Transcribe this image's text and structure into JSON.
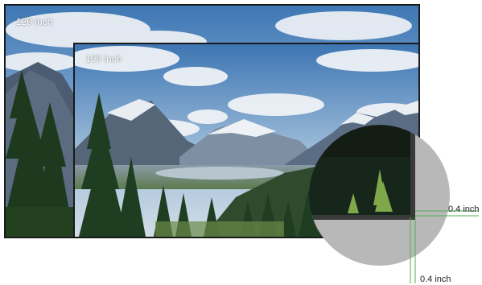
{
  "screens": {
    "outer": {
      "label": "120 inch"
    },
    "inner": {
      "label": "100 inch"
    }
  },
  "bezel": {
    "right_label": "0.4 inch",
    "bottom_label": "0.4 inch"
  },
  "colors": {
    "frame": "#1a1a1a",
    "callout_lines": "#4caf50",
    "magnifier_bg": "#b8b8b8",
    "label_text": "#ffffff"
  }
}
